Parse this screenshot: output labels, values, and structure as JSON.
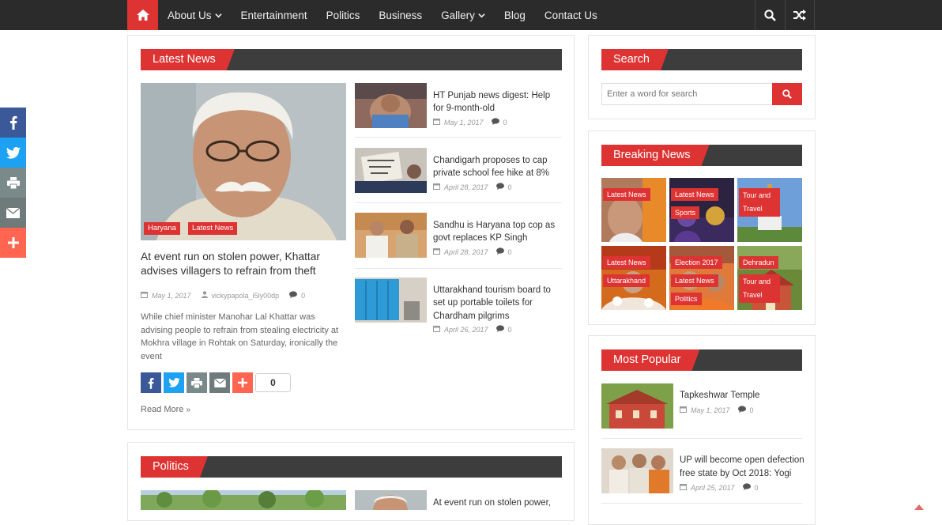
{
  "nav": {
    "items": [
      {
        "label": "About Us",
        "dropdown": true
      },
      {
        "label": "Entertainment",
        "dropdown": false
      },
      {
        "label": "Politics",
        "dropdown": false
      },
      {
        "label": "Business",
        "dropdown": false
      },
      {
        "label": "Gallery",
        "dropdown": true
      },
      {
        "label": "Blog",
        "dropdown": false
      },
      {
        "label": "Contact Us",
        "dropdown": false
      }
    ],
    "icons": [
      "home-icon",
      "search-icon",
      "random-icon"
    ],
    "accent": "#dd3333",
    "bg": "#2b2b2b"
  },
  "share_bar": {
    "icons": [
      "facebook-icon",
      "twitter-icon",
      "print-icon",
      "email-icon",
      "plus-icon"
    ],
    "colors": [
      "#3b5998",
      "#1da1f2",
      "#7a8a8a",
      "#6f7a7a",
      "#ff6550"
    ]
  },
  "latest": {
    "heading": "Latest News",
    "main": {
      "badges": [
        "Haryana",
        "Latest News"
      ],
      "title": "At event run on stolen power, Khattar advises villagers to refrain from theft",
      "date": "May 1, 2017",
      "author": "vickypapola_i5ly00dp",
      "comments": "0",
      "excerpt": "While chief minister Manohar Lal Khattar was advising people to refrain from stealing electricity at Mokhra village in Rohtak on Saturday, ironically the event",
      "share_count": "0",
      "read_more": "Read More"
    },
    "list": [
      {
        "title": "HT Punjab news digest: Help for 9-month-old",
        "date": "May 1, 2017",
        "comments": "0"
      },
      {
        "title": "Chandigarh proposes to cap private school fee hike at 8%",
        "date": "April 28, 2017",
        "comments": "0"
      },
      {
        "title": "Sandhu is Haryana top cop as govt replaces KP Singh",
        "date": "April 28, 2017",
        "comments": "0"
      },
      {
        "title": "Uttarakhand tourism board to set up portable toilets for Chardham pilgrims",
        "date": "April 26, 2017",
        "comments": "0"
      }
    ]
  },
  "politics": {
    "heading": "Politics",
    "first_title": "At event run on stolen power,"
  },
  "search": {
    "heading": "Search",
    "placeholder": "Enter a word for search"
  },
  "breaking": {
    "heading": "Breaking News",
    "cells": [
      {
        "badges": [
          "Latest News"
        ]
      },
      {
        "badges": [
          "Latest News",
          "Sports"
        ]
      },
      {
        "badges": [
          "Tour and Travel"
        ]
      },
      {
        "badges": [
          "Latest News",
          "Uttarakhand"
        ]
      },
      {
        "badges": [
          "Election 2017",
          "Latest News",
          "Politics"
        ]
      },
      {
        "badges": [
          "Dehradun",
          "Tour and Travel"
        ]
      }
    ]
  },
  "popular": {
    "heading": "Most Popular",
    "items": [
      {
        "title": "Tapkeshwar Temple",
        "date": "May 1, 2017",
        "comments": "0"
      },
      {
        "title": "UP will become open defection free state by Oct 2018: Yogi",
        "date": "April 25, 2017",
        "comments": "0"
      }
    ]
  }
}
